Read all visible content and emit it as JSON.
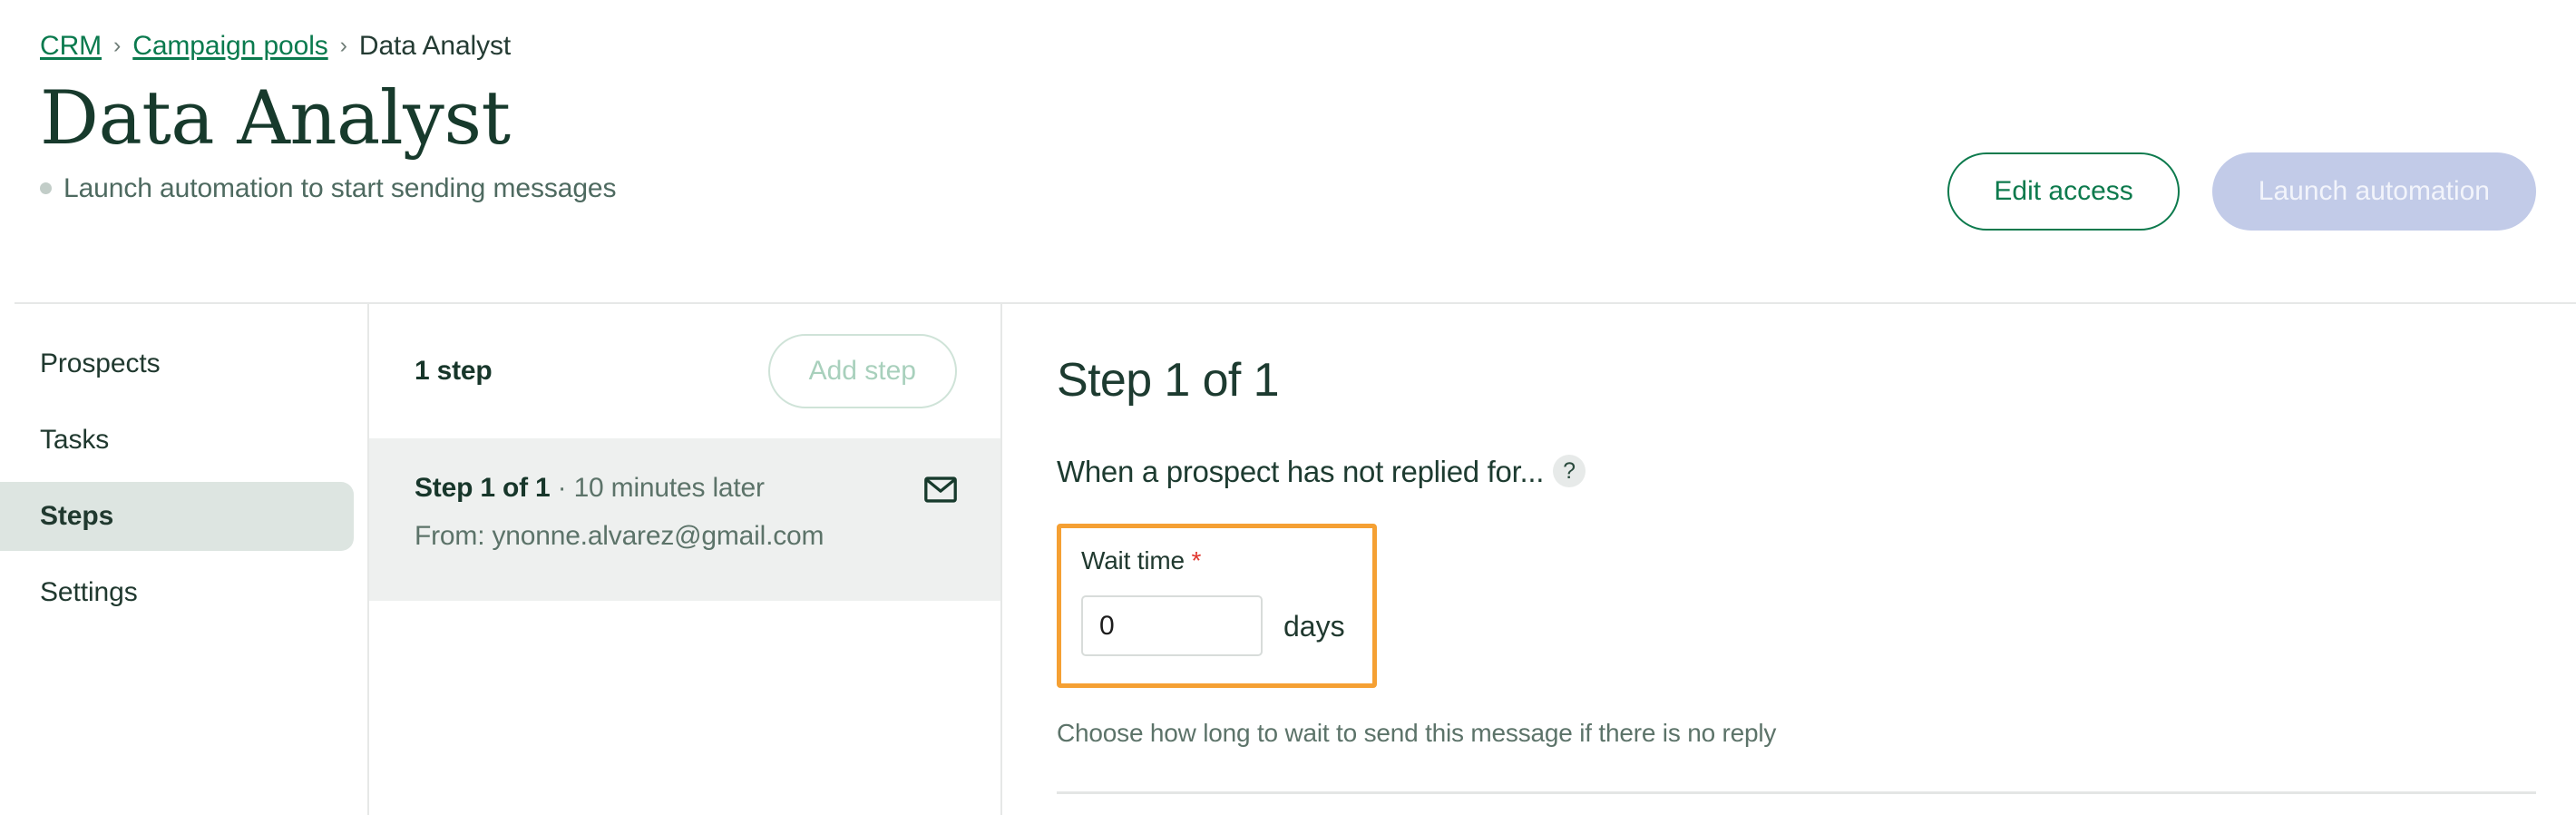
{
  "breadcrumb": {
    "items": [
      {
        "label": "CRM",
        "link": true
      },
      {
        "label": "Campaign pools",
        "link": true
      },
      {
        "label": "Data Analyst",
        "link": false
      }
    ],
    "separator": "›"
  },
  "header": {
    "title": "Data Analyst",
    "subtitle": "Launch automation to start sending messages",
    "edit_access_label": "Edit access",
    "launch_automation_label": "Launch automation"
  },
  "sidebar": {
    "items": [
      {
        "label": "Prospects",
        "active": false
      },
      {
        "label": "Tasks",
        "active": false
      },
      {
        "label": "Steps",
        "active": true
      },
      {
        "label": "Settings",
        "active": false
      }
    ]
  },
  "steps_panel": {
    "count_label": "1 step",
    "add_step_label": "Add step",
    "steps": [
      {
        "name": "Step 1 of 1",
        "meta": "· 10 minutes later",
        "from": "From: ynonne.alvarez@gmail.com",
        "icon": "envelope-icon"
      }
    ]
  },
  "content": {
    "title": "Step 1 of 1",
    "condition_text": "When a prospect has not replied for...",
    "help_badge": "?",
    "wait_time": {
      "label": "Wait time",
      "required_mark": "*",
      "value": "0",
      "placeholder": "0",
      "unit": "days",
      "help_text": "Choose how long to wait to send this message if there is no reply"
    }
  },
  "colors": {
    "brand_green": "#0d7a4d",
    "title_green": "#173a2c",
    "disabled_button_bg": "#c2cbe8",
    "highlight_orange": "#f5a033",
    "active_nav_bg": "#dde5e1",
    "step_row_bg": "#eef0ef",
    "required_red": "#e0342c"
  }
}
